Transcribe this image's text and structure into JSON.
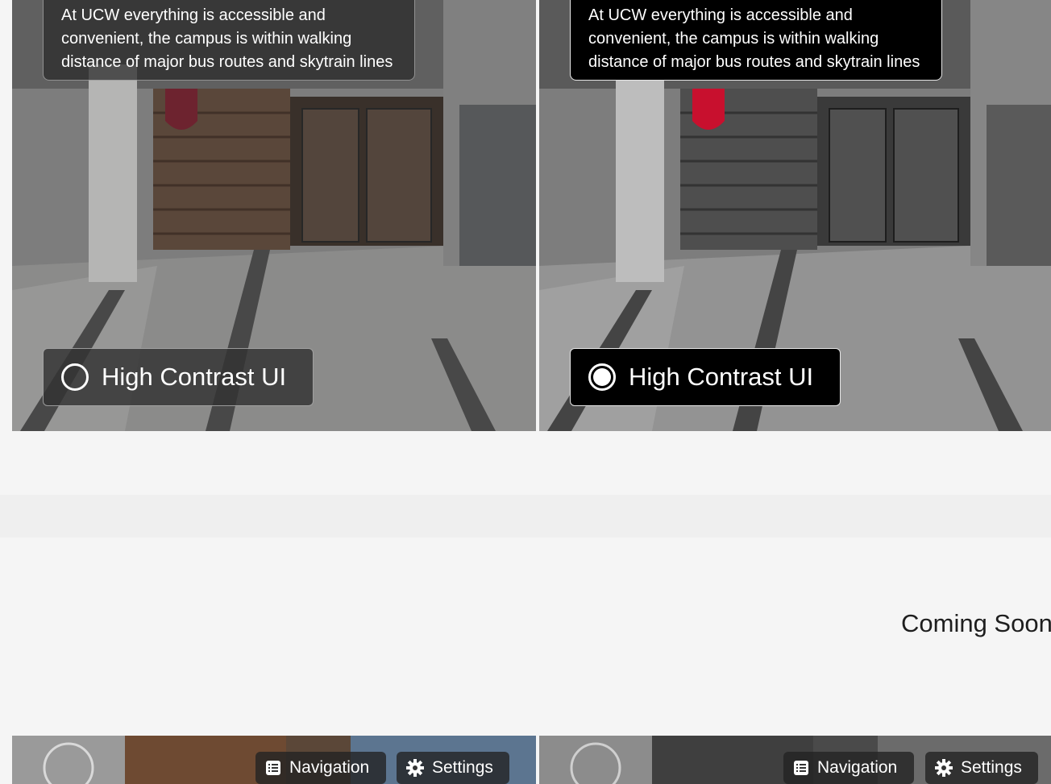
{
  "panels": [
    {
      "id": "standard",
      "caption": "At UCW everything is accessible and convenient, the campus is within walking distance of major bus routes and skytrain lines",
      "toggle": {
        "label": "High Contrast UI",
        "checked": false
      }
    },
    {
      "id": "high-contrast",
      "caption": "At UCW everything is accessible and convenient, the campus is within walking distance of major bus routes and skytrain lines",
      "toggle": {
        "label": "High Contrast UI",
        "checked": true
      }
    }
  ],
  "coming_soon": "Coming Soon",
  "bottom_toolbar": {
    "navigation_label": "Navigation",
    "settings_label": "Settings",
    "icons": [
      "list-icon",
      "gear-icon"
    ]
  },
  "colors": {
    "page_bg": "#f5f5f5",
    "band_bg": "#efefef",
    "high_contrast_bg": "#000000",
    "brand_red": "#c8102e"
  }
}
